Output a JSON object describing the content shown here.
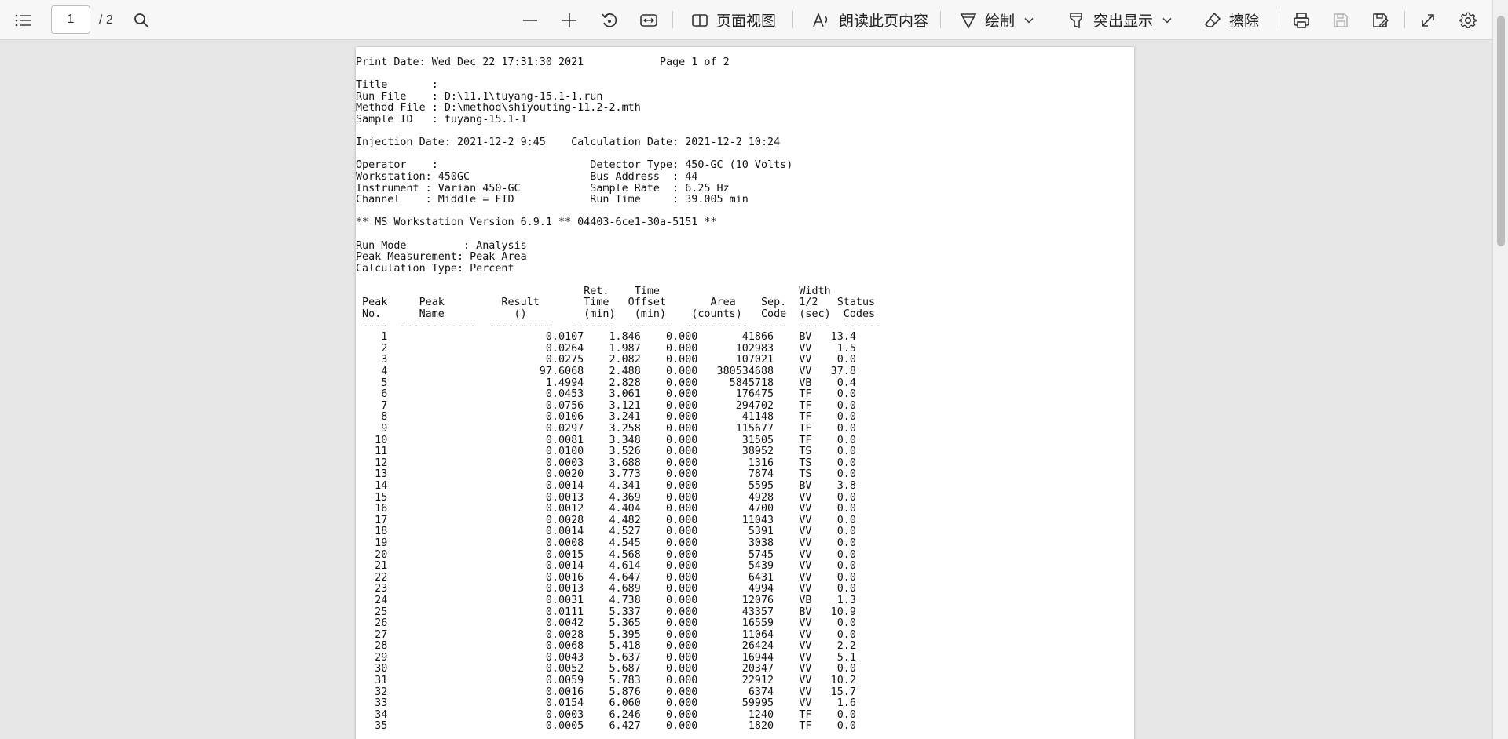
{
  "toolbar": {
    "current_page": "1",
    "total_pages": "/ 2",
    "page_view_label": "页面视图",
    "read_aloud_label": "朗读此页内容",
    "draw_label": "绘制",
    "highlight_label": "突出显示",
    "erase_label": "擦除",
    "icons": [
      "contents-icon",
      "search-icon",
      "zoom-out-icon",
      "zoom-in-icon",
      "rotate-icon",
      "fit-width-icon",
      "page-view-icon",
      "read-aloud-icon",
      "draw-icon",
      "highlight-icon",
      "eraser-icon",
      "print-icon",
      "save-icon",
      "save-as-icon",
      "fullscreen-icon",
      "settings-icon"
    ]
  },
  "document": {
    "header_lines": [
      "Print Date: Wed Dec 22 17:31:30 2021            Page 1 of 2",
      "",
      "Title       :",
      "Run File    : D:\\11.1\\tuyang-15.1-1.run",
      "Method File : D:\\method\\shiyouting-11.2-2.mth",
      "Sample ID   : tuyang-15.1-1",
      "",
      "Injection Date: 2021-12-2 9:45    Calculation Date: 2021-12-2 10:24",
      "",
      "Operator    :                        Detector Type: 450-GC (10 Volts)",
      "Workstation: 450GC                   Bus Address  : 44",
      "Instrument : Varian 450-GC           Sample Rate  : 6.25 Hz",
      "Channel    : Middle = FID            Run Time     : 39.005 min",
      "",
      "** MS Workstation Version 6.9.1 ** 04403-6ce1-30a-5151 **",
      "",
      "Run Mode         : Analysis",
      "Peak Measurement: Peak Area",
      "Calculation Type: Percent",
      "",
      "                                    Ret.    Time                      Width",
      " Peak     Peak         Result       Time   Offset       Area    Sep.  1/2   Status",
      " No.      Name           ()         (min)   (min)    (counts)   Code  (sec)  Codes",
      " ----  ------------  ----------   -------  -------  ----------  ----  -----  ------"
    ],
    "table_rows": [
      [
        "1",
        "0.0107",
        "1.846",
        "0.000",
        "41866",
        "BV",
        "13.4"
      ],
      [
        "2",
        "0.0264",
        "1.987",
        "0.000",
        "102983",
        "VV",
        "1.5"
      ],
      [
        "3",
        "0.0275",
        "2.082",
        "0.000",
        "107021",
        "VV",
        "0.0"
      ],
      [
        "4",
        "97.6068",
        "2.488",
        "0.000",
        "380534688",
        "VV",
        "37.8"
      ],
      [
        "5",
        "1.4994",
        "2.828",
        "0.000",
        "5845718",
        "VB",
        "0.4"
      ],
      [
        "6",
        "0.0453",
        "3.061",
        "0.000",
        "176475",
        "TF",
        "0.0"
      ],
      [
        "7",
        "0.0756",
        "3.121",
        "0.000",
        "294702",
        "TF",
        "0.0"
      ],
      [
        "8",
        "0.0106",
        "3.241",
        "0.000",
        "41148",
        "TF",
        "0.0"
      ],
      [
        "9",
        "0.0297",
        "3.258",
        "0.000",
        "115677",
        "TF",
        "0.0"
      ],
      [
        "10",
        "0.0081",
        "3.348",
        "0.000",
        "31505",
        "TF",
        "0.0"
      ],
      [
        "11",
        "0.0100",
        "3.526",
        "0.000",
        "38952",
        "TS",
        "0.0"
      ],
      [
        "12",
        "0.0003",
        "3.688",
        "0.000",
        "1316",
        "TS",
        "0.0"
      ],
      [
        "13",
        "0.0020",
        "3.773",
        "0.000",
        "7874",
        "TS",
        "0.0"
      ],
      [
        "14",
        "0.0014",
        "4.341",
        "0.000",
        "5595",
        "BV",
        "3.8"
      ],
      [
        "15",
        "0.0013",
        "4.369",
        "0.000",
        "4928",
        "VV",
        "0.0"
      ],
      [
        "16",
        "0.0012",
        "4.404",
        "0.000",
        "4700",
        "VV",
        "0.0"
      ],
      [
        "17",
        "0.0028",
        "4.482",
        "0.000",
        "11043",
        "VV",
        "0.0"
      ],
      [
        "18",
        "0.0014",
        "4.527",
        "0.000",
        "5391",
        "VV",
        "0.0"
      ],
      [
        "19",
        "0.0008",
        "4.545",
        "0.000",
        "3038",
        "VV",
        "0.0"
      ],
      [
        "20",
        "0.0015",
        "4.568",
        "0.000",
        "5745",
        "VV",
        "0.0"
      ],
      [
        "21",
        "0.0014",
        "4.614",
        "0.000",
        "5439",
        "VV",
        "0.0"
      ],
      [
        "22",
        "0.0016",
        "4.647",
        "0.000",
        "6431",
        "VV",
        "0.0"
      ],
      [
        "23",
        "0.0013",
        "4.689",
        "0.000",
        "4994",
        "VV",
        "0.0"
      ],
      [
        "24",
        "0.0031",
        "4.738",
        "0.000",
        "12076",
        "VB",
        "1.3"
      ],
      [
        "25",
        "0.0111",
        "5.337",
        "0.000",
        "43357",
        "BV",
        "10.9"
      ],
      [
        "26",
        "0.0042",
        "5.365",
        "0.000",
        "16559",
        "VV",
        "0.0"
      ],
      [
        "27",
        "0.0028",
        "5.395",
        "0.000",
        "11064",
        "VV",
        "0.0"
      ],
      [
        "28",
        "0.0068",
        "5.418",
        "0.000",
        "26424",
        "VV",
        "2.2"
      ],
      [
        "29",
        "0.0043",
        "5.637",
        "0.000",
        "16944",
        "VV",
        "5.1"
      ],
      [
        "30",
        "0.0052",
        "5.687",
        "0.000",
        "20347",
        "VV",
        "0.0"
      ],
      [
        "31",
        "0.0059",
        "5.783",
        "0.000",
        "22912",
        "VV",
        "10.2"
      ],
      [
        "32",
        "0.0016",
        "5.876",
        "0.000",
        "6374",
        "VV",
        "15.7"
      ],
      [
        "33",
        "0.0154",
        "6.060",
        "0.000",
        "59995",
        "VV",
        "1.6"
      ],
      [
        "34",
        "0.0003",
        "6.246",
        "0.000",
        "1240",
        "TF",
        "0.0"
      ],
      [
        "35",
        "0.0005",
        "6.427",
        "0.000",
        "1820",
        "TF",
        "0.0"
      ]
    ]
  }
}
